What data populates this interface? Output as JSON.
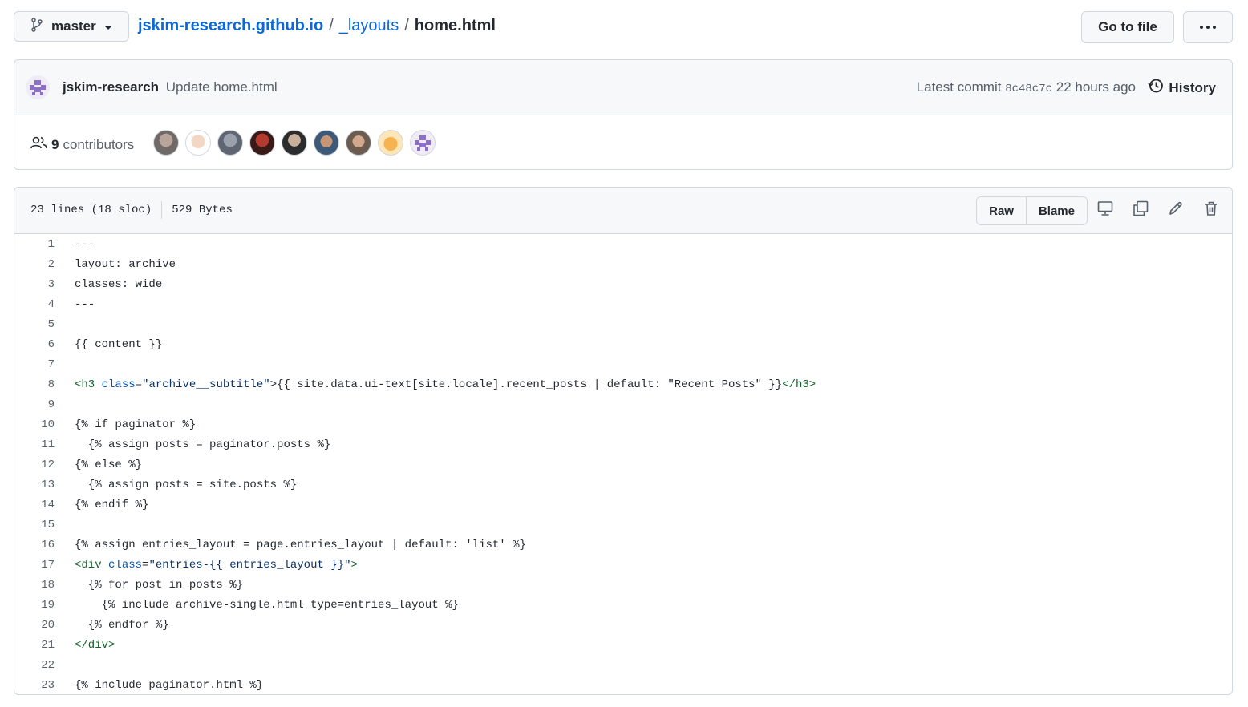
{
  "branch": {
    "label": "master"
  },
  "breadcrumb": {
    "repo": "jskim-research.github.io",
    "folder": "_layouts",
    "file": "home.html",
    "separator": "/"
  },
  "actions": {
    "goto_label": "Go to file"
  },
  "commit": {
    "author": "jskim-research",
    "message": "Update home.html",
    "latest_label": "Latest commit",
    "sha": "8c48c7c",
    "time": "22 hours ago",
    "history_label": "History"
  },
  "contributors": {
    "count": "9",
    "label": "contributors"
  },
  "file": {
    "lines_info": "23 lines (18 sloc)",
    "size": "529 Bytes",
    "raw_label": "Raw",
    "blame_label": "Blame"
  },
  "code": {
    "line_numbers": [
      "1",
      "2",
      "3",
      "4",
      "5",
      "6",
      "7",
      "8",
      "9",
      "10",
      "11",
      "12",
      "13",
      "14",
      "15",
      "16",
      "17",
      "18",
      "19",
      "20",
      "21",
      "22",
      "23"
    ],
    "l1": "---",
    "l2": "layout: archive",
    "l3": "classes: wide",
    "l4": "---",
    "l5": "",
    "l6": "{{ content }}",
    "l7": "",
    "l8_open": "<h3",
    "l8_attr": "class",
    "l8_eq": "=",
    "l8_str": "\"archive__subtitle\"",
    "l8_rest": ">{{ site.data.ui-text[site.locale].recent_posts | default: \"Recent Posts\" }}",
    "l8_close": "</h3>",
    "l9": "",
    "l10": "{% if paginator %}",
    "l11": "  {% assign posts = paginator.posts %}",
    "l12": "{% else %}",
    "l13": "  {% assign posts = site.posts %}",
    "l14": "{% endif %}",
    "l15": "",
    "l16": "{% assign entries_layout = page.entries_layout | default: 'list' %}",
    "l17_open": "<div",
    "l17_attr": "class",
    "l17_eq": "=",
    "l17_str": "\"entries-{{ entries_layout }}\"",
    "l17_close": ">",
    "l18": "  {% for post in posts %}",
    "l19": "    {% include archive-single.html type=entries_layout %}",
    "l20": "  {% endfor %}",
    "l21": "</div>",
    "l22": "",
    "l23": "{% include paginator.html %}"
  }
}
